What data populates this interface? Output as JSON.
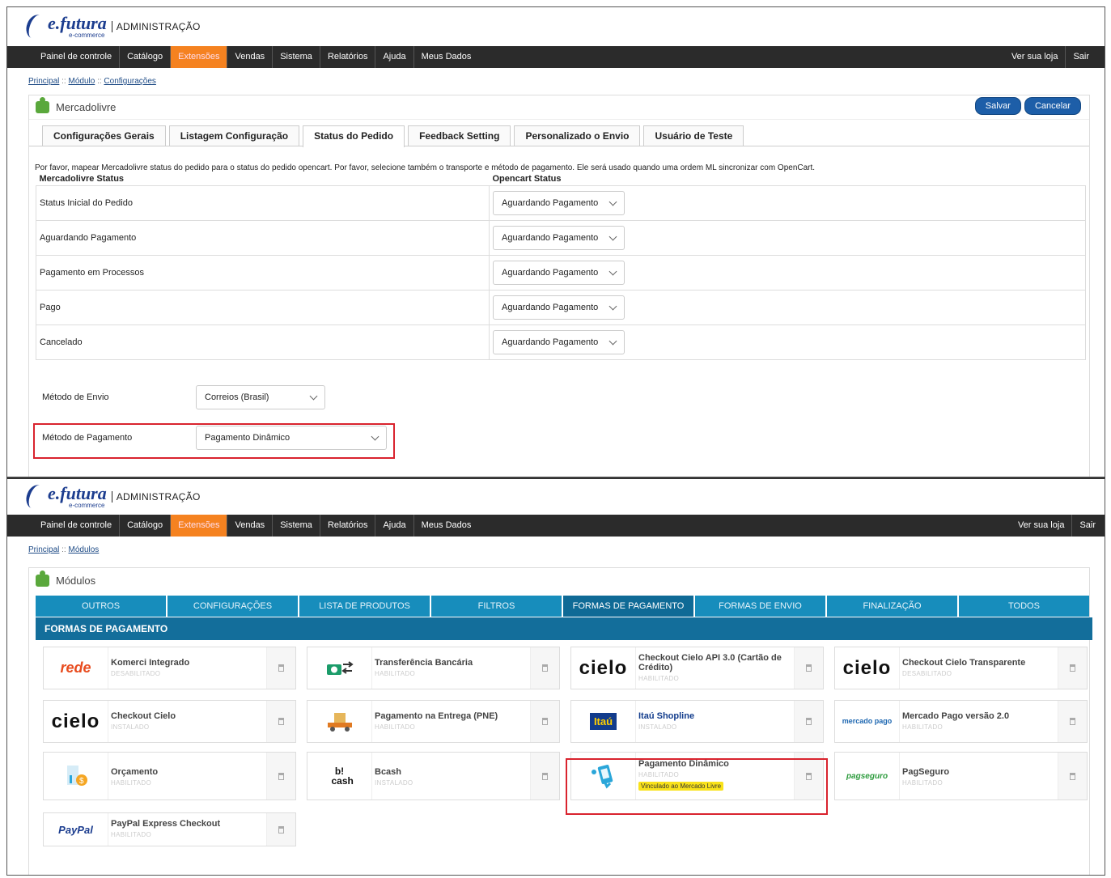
{
  "brand": {
    "name": "e.futura",
    "sub": "e-commerce",
    "admin": "ADMINISTRAÇÃO"
  },
  "nav": {
    "items": [
      "Painel de controle",
      "Catálogo",
      "Extensões",
      "Vendas",
      "Sistema",
      "Relatórios",
      "Ajuda",
      "Meus Dados"
    ],
    "active": "Extensões",
    "right": [
      "Ver sua loja",
      "Sair"
    ]
  },
  "screen1": {
    "breadcrumb": [
      "Principal",
      "Módulo",
      "Configurações"
    ],
    "title": "Mercadolivre",
    "buttons": {
      "save": "Salvar",
      "cancel": "Cancelar"
    },
    "tabs": [
      "Configurações Gerais",
      "Listagem Configuração",
      "Status do Pedido",
      "Feedback Setting",
      "Personalizado o Envio",
      "Usuário de Teste"
    ],
    "active_tab": "Status do Pedido",
    "intro": "Por favor, mapear Mercadolivre status do pedido para o status do pedido opencart. Por favor, selecione também o transporte e método de pagamento. Ele será usado quando uma ordem ML sincronizar com OpenCart.",
    "table_headers": [
      "Mercadolivre Status",
      "Opencart Status"
    ],
    "rows": [
      {
        "label": "Status Inicial do Pedido",
        "value": "Aguardando Pagamento"
      },
      {
        "label": "Aguardando Pagamento",
        "value": "Aguardando Pagamento"
      },
      {
        "label": "Pagamento em Processos",
        "value": "Aguardando Pagamento"
      },
      {
        "label": "Pago",
        "value": "Aguardando Pagamento"
      },
      {
        "label": "Cancelado",
        "value": "Aguardando Pagamento"
      }
    ],
    "shipping": {
      "label": "Método de Envio",
      "value": "Correios (Brasil)"
    },
    "payment": {
      "label": "Método de Pagamento",
      "value": "Pagamento Dinâmico"
    }
  },
  "screen2": {
    "breadcrumb": [
      "Principal",
      "Módulos"
    ],
    "title": "Módulos",
    "category_tabs": [
      "OUTROS",
      "CONFIGURAÇÕES",
      "LISTA DE PRODUTOS",
      "FILTROS",
      "FORMAS DE PAGAMENTO",
      "FORMAS DE ENVIO",
      "FINALIZAÇÃO",
      "TODOS"
    ],
    "active_category": "FORMAS DE PAGAMENTO",
    "section_title": "FORMAS DE PAGAMENTO",
    "modules": [
      {
        "name": "Komerci Integrado",
        "status": "DESABILITADO",
        "logo": "rede"
      },
      {
        "name": "Transferência Bancária",
        "status": "HABILITADO",
        "logo": "bank-transfer-icon"
      },
      {
        "name": "Checkout Cielo API 3.0 (Cartão de Crédito)",
        "status": "HABILITADO",
        "logo": "cielo"
      },
      {
        "name": "Checkout Cielo Transparente",
        "status": "DESABILITADO",
        "logo": "cielo"
      },
      {
        "name": "Checkout Cielo",
        "status": "INSTALADO",
        "logo": "cielo"
      },
      {
        "name": "Pagamento na Entrega (PNE)",
        "status": "HABILITADO",
        "logo": "truck-icon"
      },
      {
        "name": "Itaú Shopline",
        "status": "INSTALADO",
        "logo": "Itaú"
      },
      {
        "name": "Mercado Pago versão 2.0",
        "status": "HABILITADO",
        "logo": "mercado pago"
      },
      {
        "name": "Orçamento",
        "status": "HABILITADO",
        "logo": "budget-icon"
      },
      {
        "name": "Bcash",
        "status": "INSTALADO",
        "logo": "b! cash"
      },
      {
        "name": "Pagamento Dinâmico",
        "status": "HABILITADO",
        "logo": "payment-phone-icon",
        "badge": "Vinculado ao Mercado Livre"
      },
      {
        "name": "PagSeguro",
        "status": "HABILITADO",
        "logo": "pagseguro"
      },
      {
        "name": "PayPal Express Checkout",
        "status": "HABILITADO",
        "logo": "PayPal"
      }
    ]
  },
  "colors": {
    "nav": "#2b2b2b",
    "accent": "#f58220",
    "tab_blue": "#178dbc",
    "header_blue": "#136e9b",
    "highlight": "#d9232e"
  }
}
